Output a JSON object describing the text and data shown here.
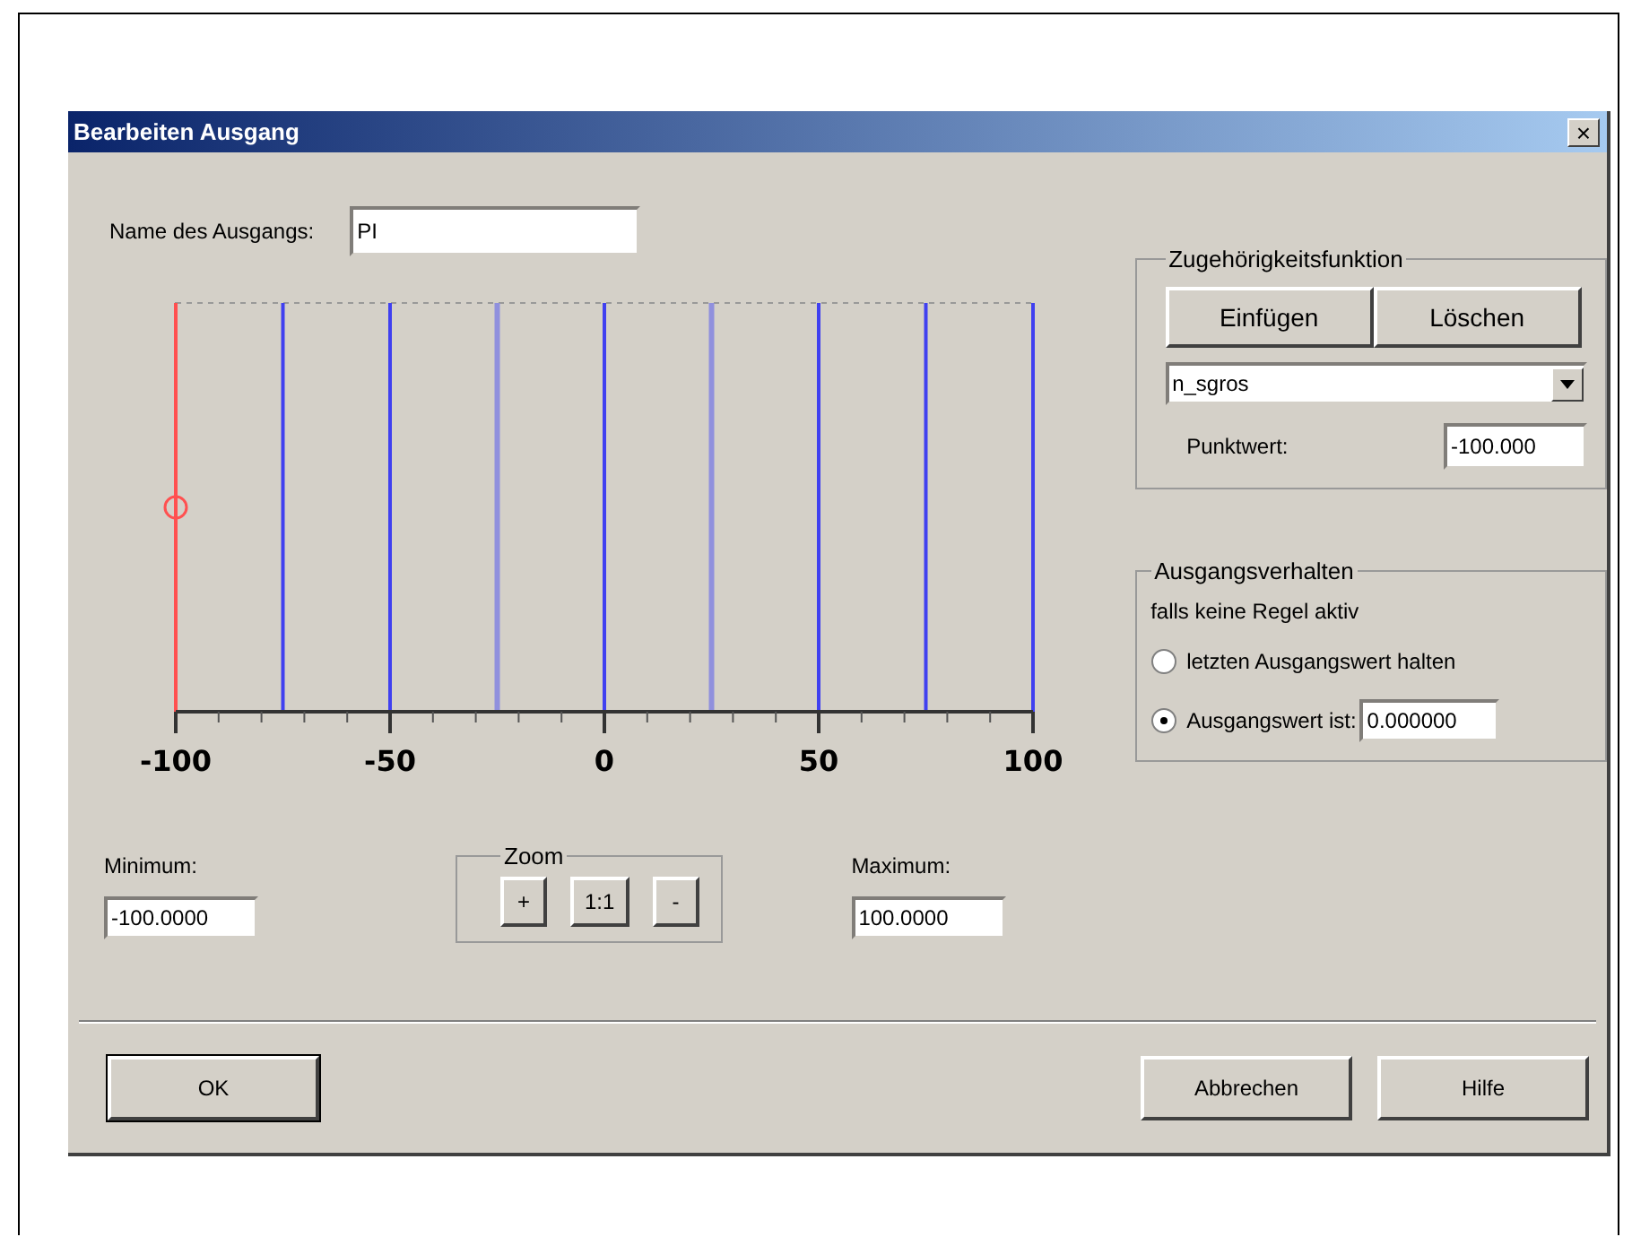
{
  "window": {
    "title": "Bearbeiten Ausgang",
    "close": "×"
  },
  "name_field": {
    "label": "Name des Ausgangs:",
    "value": "PI"
  },
  "plot": {
    "tick_labels": [
      "-100",
      "-50",
      "0",
      "50",
      "100"
    ],
    "lines": [
      {
        "selected": true,
        "highlighted": false
      },
      {
        "selected": false,
        "highlighted": false
      },
      {
        "selected": false,
        "highlighted": false
      },
      {
        "selected": false,
        "highlighted": true
      },
      {
        "selected": false,
        "highlighted": false
      },
      {
        "selected": false,
        "highlighted": true
      },
      {
        "selected": false,
        "highlighted": false
      },
      {
        "selected": false,
        "highlighted": false
      },
      {
        "selected": false,
        "highlighted": false
      }
    ]
  },
  "minimum": {
    "label": "Minimum:",
    "value": "-100.0000"
  },
  "zoom": {
    "title": "Zoom",
    "buttons": [
      "+",
      "1:1",
      "-"
    ]
  },
  "maximum": {
    "label": "Maximum:",
    "value": "100.0000"
  },
  "membership": {
    "title": "Zugehörigkeitsfunktion",
    "buttons": [
      "Einfügen",
      "Löschen"
    ],
    "dropdown": "n_sgros",
    "point_label": "Punktwert:",
    "point_value": "-100.000"
  },
  "output_behavior": {
    "title": "Ausgangsverhalten",
    "note": "falls keine Regel aktiv",
    "options": [
      {
        "label": "letzten Ausgangswert halten",
        "selected": false
      },
      {
        "label": "Ausgangswert ist:",
        "selected": true,
        "value": "0.000000"
      }
    ]
  },
  "buttons": [
    {
      "label": "OK",
      "default": true
    },
    {
      "label": "Abbrechen",
      "default": false
    },
    {
      "label": "Hilfe",
      "default": false
    }
  ]
}
